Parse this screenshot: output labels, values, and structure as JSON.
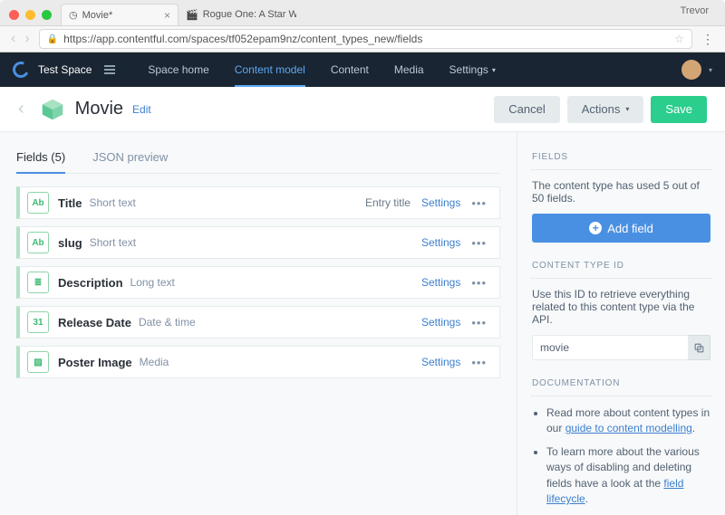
{
  "browser": {
    "tabs": [
      {
        "title": "Movie*",
        "favicon": "◷"
      },
      {
        "title": "Rogue One: A Star Wars Story",
        "favicon": "🎬"
      }
    ],
    "profile": "Trevor",
    "url": "https://app.contentful.com/spaces/tf052epam9nz/content_types_new/fields"
  },
  "nav": {
    "space": "Test Space",
    "items": [
      "Space home",
      "Content model",
      "Content",
      "Media",
      "Settings"
    ],
    "active_index": 1
  },
  "titlebar": {
    "title": "Movie",
    "edit": "Edit",
    "cancel": "Cancel",
    "actions": "Actions",
    "save": "Save"
  },
  "tabs": {
    "fields_label": "Fields (5)",
    "json_label": "JSON preview"
  },
  "fields": [
    {
      "icon": "Ab",
      "name": "Title",
      "type": "Short text",
      "entry_title": "Entry title",
      "settings": "Settings"
    },
    {
      "icon": "Ab",
      "name": "slug",
      "type": "Short text",
      "entry_title": "",
      "settings": "Settings"
    },
    {
      "icon": "≣",
      "name": "Description",
      "type": "Long text",
      "entry_title": "",
      "settings": "Settings"
    },
    {
      "icon": "31",
      "name": "Release Date",
      "type": "Date & time",
      "entry_title": "",
      "settings": "Settings"
    },
    {
      "icon": "▨",
      "name": "Poster Image",
      "type": "Media",
      "entry_title": "",
      "settings": "Settings"
    }
  ],
  "sidebar": {
    "fields_heading": "FIELDS",
    "usage": "The content type has used 5 out of 50 fields.",
    "add_field": "Add field",
    "ctid_heading": "CONTENT TYPE ID",
    "ctid_desc": "Use this ID to retrieve everything related to this content type via the API.",
    "ctid_value": "movie",
    "doc_heading": "DOCUMENTATION",
    "doc1_pre": "Read more about content types in our ",
    "doc1_link": "guide to content modelling",
    "doc1_post": ".",
    "doc2_pre": "To learn more about the various ways of disabling and deleting fields have a look at the ",
    "doc2_link": "field lifecycle",
    "doc2_post": "."
  }
}
